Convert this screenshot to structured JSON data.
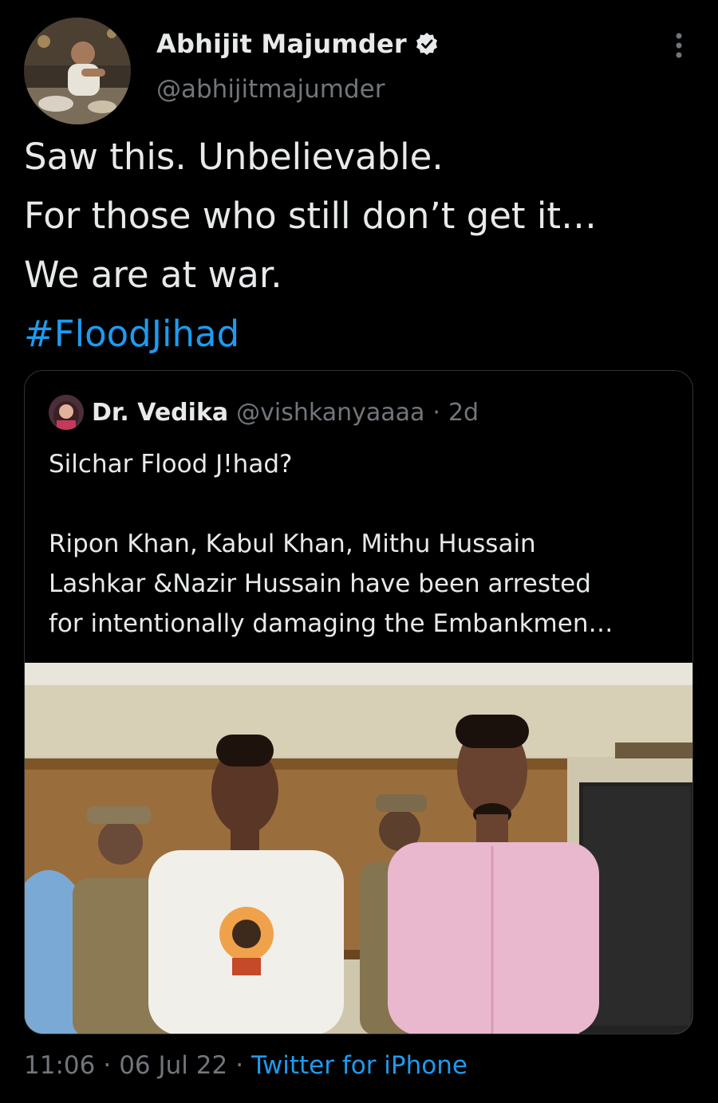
{
  "author": {
    "name": "Abhijit Majumder",
    "handle": "@abhijitmajumder"
  },
  "tweet": {
    "lines": [
      "Saw this. Unbelievable.",
      "For those who still don’t get it…",
      "We are at war."
    ],
    "hashtag": "#FloodJihad"
  },
  "quoted": {
    "name": "Dr. Vedika",
    "handle": "@vishkanyaaaa",
    "separator": "·",
    "age": "2d",
    "lines": [
      "Silchar Flood J!had?",
      "",
      "Ripon Khan, Kabul Khan, Mithu Hussain",
      "Lashkar &Nazir Hussain have been arrested",
      "for intentionally damaging the Embankmen…"
    ]
  },
  "meta": {
    "time": "11:06",
    "separator": "·",
    "date": "06 Jul 22",
    "source": "Twitter for iPhone"
  },
  "colors": {
    "background": "#000000",
    "text": "#e7e9ea",
    "muted": "#71767b",
    "accent": "#1d9bf0",
    "border": "#2f3336"
  }
}
